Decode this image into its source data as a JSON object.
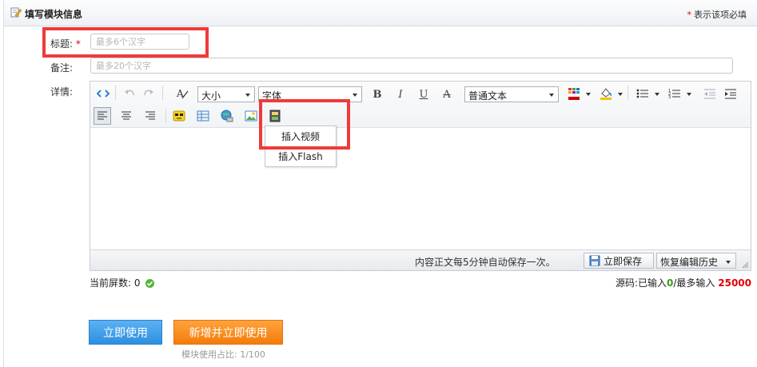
{
  "header": {
    "title": "填写模块信息",
    "required_star": "*",
    "required_note": "表示该项必填"
  },
  "form": {
    "title_label": "标题:",
    "title_required": "*",
    "title_placeholder": "最多6个汉字",
    "remark_label": "备注:",
    "remark_placeholder": "最多20个汉字",
    "detail_label": "详情:"
  },
  "toolbar": {
    "size_select": "大小",
    "font_select": "字体",
    "bold": "B",
    "italic": "I",
    "underline": "U",
    "strike": "A",
    "format_select": "普通文本"
  },
  "video_menu": {
    "items": [
      "插入视频",
      "插入Flash"
    ]
  },
  "statusbar": {
    "autosave_text": "内容正文每5分钟自动保存一次。",
    "save_button": "立即保存",
    "history_button": "恢复编辑历史"
  },
  "stats": {
    "screens_label": "当前屏数:",
    "screens_value": "0",
    "source_label": "源码:已输入",
    "source_entered": "0",
    "source_max_label": "/最多输入",
    "source_max": "25000"
  },
  "actions": {
    "use_now": "立即使用",
    "add_and_use": "新增并立即使用",
    "usage_text": "模块使用占比: 1/100"
  },
  "colors": {
    "highlight_box": "#f03a3a",
    "required_red": "#e30000",
    "primary_blue": "#2d8fe0",
    "primary_orange": "#f57c0a",
    "ok_green": "#55b535"
  }
}
